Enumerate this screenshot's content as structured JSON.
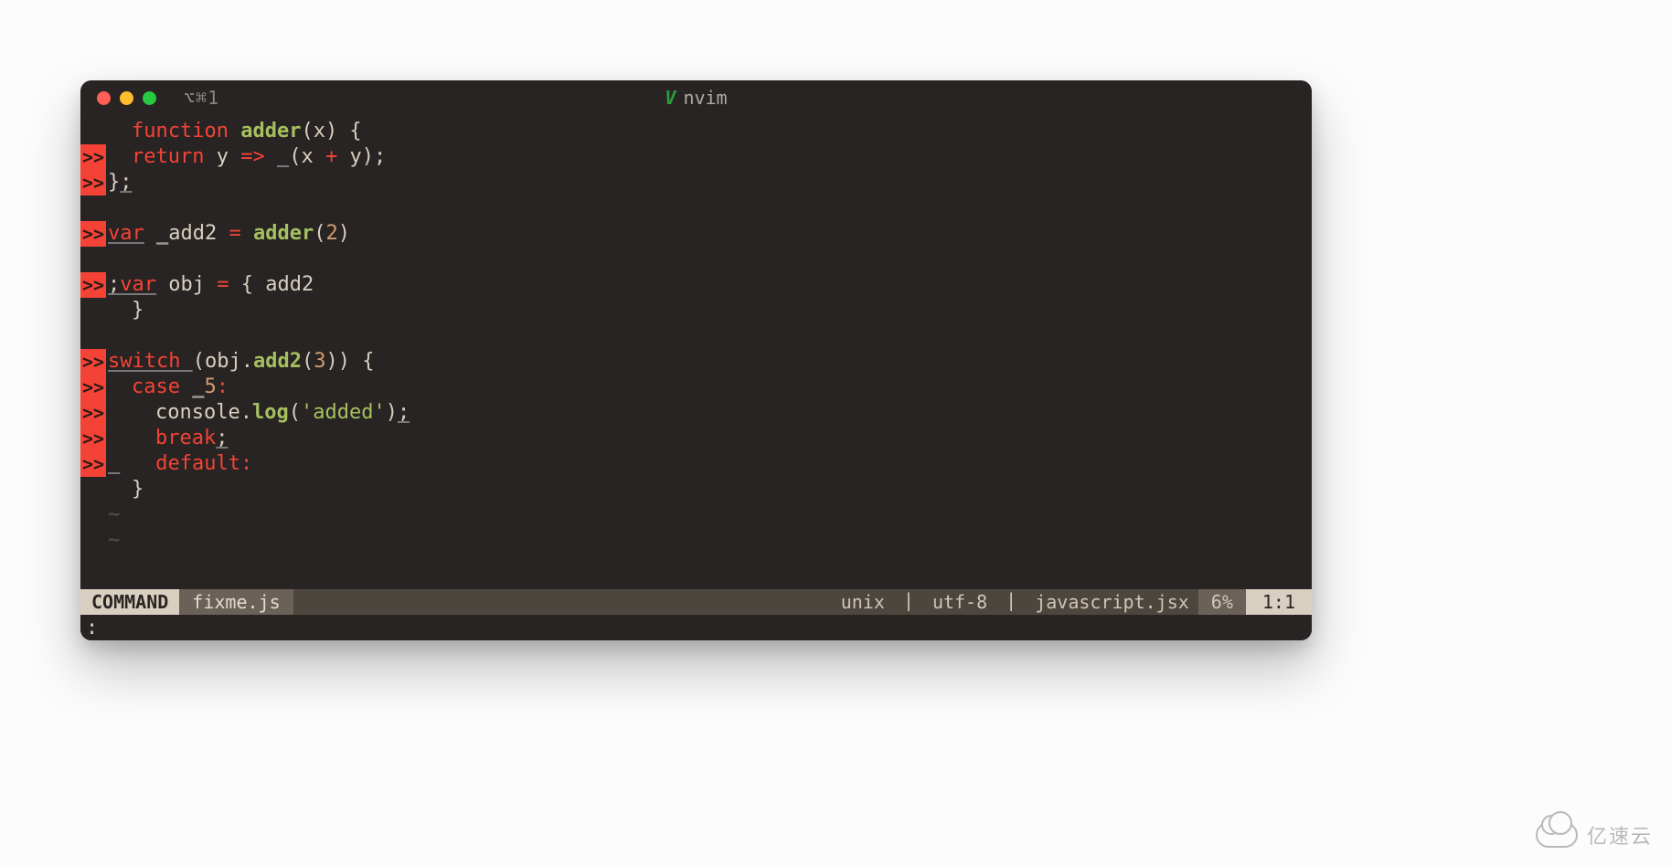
{
  "titlebar": {
    "tab_label": "⌥⌘1",
    "app_icon": "V",
    "app_title": "nvim"
  },
  "gutter_marker": ">>",
  "code": {
    "lines": [
      {
        "err": false,
        "segments": [
          {
            "cls": "indent w2",
            "t": ""
          },
          {
            "cls": "kw",
            "t": "function "
          },
          {
            "cls": "fn",
            "t": "adder"
          },
          {
            "cls": "punct",
            "t": "(x) {"
          }
        ]
      },
      {
        "err": true,
        "segments": [
          {
            "cls": "indent w2",
            "t": ""
          },
          {
            "cls": "kw",
            "t": "return "
          },
          {
            "cls": "ident",
            "t": "y "
          },
          {
            "cls": "kw",
            "t": "=> "
          },
          {
            "cls": "ident ul",
            "t": " "
          },
          {
            "cls": "punct",
            "t": "(x "
          },
          {
            "cls": "kw",
            "t": "+"
          },
          {
            "cls": "punct",
            "t": " y);"
          }
        ]
      },
      {
        "err": true,
        "segments": [
          {
            "cls": "punct",
            "t": "}"
          },
          {
            "cls": "punct ul",
            "t": ";"
          }
        ]
      },
      {
        "err": false,
        "segments": [
          {
            "cls": "",
            "t": ""
          }
        ]
      },
      {
        "err": true,
        "segments": [
          {
            "cls": "kw ul",
            "t": "var"
          },
          {
            "cls": "ident",
            "t": " "
          },
          {
            "cls": "ident ul",
            "t": "_"
          },
          {
            "cls": "ident",
            "t": "add2 "
          },
          {
            "cls": "kw",
            "t": "= "
          },
          {
            "cls": "fn",
            "t": "adder"
          },
          {
            "cls": "punct",
            "t": "("
          },
          {
            "cls": "num",
            "t": "2"
          },
          {
            "cls": "punct",
            "t": ")"
          }
        ]
      },
      {
        "err": false,
        "segments": [
          {
            "cls": "",
            "t": ""
          }
        ]
      },
      {
        "err": true,
        "segments": [
          {
            "cls": "punct ul",
            "t": ";"
          },
          {
            "cls": "kw ul",
            "t": "var"
          },
          {
            "cls": "ident",
            "t": " obj "
          },
          {
            "cls": "kw",
            "t": "= "
          },
          {
            "cls": "punct",
            "t": "{ add2"
          }
        ]
      },
      {
        "err": false,
        "segments": [
          {
            "cls": "indent w2",
            "t": ""
          },
          {
            "cls": "punct",
            "t": "}"
          }
        ]
      },
      {
        "err": false,
        "segments": [
          {
            "cls": "",
            "t": ""
          }
        ]
      },
      {
        "err": true,
        "segments": [
          {
            "cls": "kw ul",
            "t": "switch"
          },
          {
            "cls": "ident ul",
            "t": " "
          },
          {
            "cls": "punct",
            "t": "(obj."
          },
          {
            "cls": "fn",
            "t": "add2"
          },
          {
            "cls": "punct",
            "t": "("
          },
          {
            "cls": "num",
            "t": "3"
          },
          {
            "cls": "punct",
            "t": ")) {"
          }
        ]
      },
      {
        "err": true,
        "segments": [
          {
            "cls": "indent w2",
            "t": ""
          },
          {
            "cls": "kw",
            "t": "case "
          },
          {
            "cls": "ident ul",
            "t": "_"
          },
          {
            "cls": "num",
            "t": "5"
          },
          {
            "cls": "kw",
            "t": ":"
          }
        ]
      },
      {
        "err": true,
        "segments": [
          {
            "cls": "indent w4",
            "t": ""
          },
          {
            "cls": "ident",
            "t": "console."
          },
          {
            "cls": "fn",
            "t": "log"
          },
          {
            "cls": "punct",
            "t": "("
          },
          {
            "cls": "str",
            "t": "'added'"
          },
          {
            "cls": "punct",
            "t": ")"
          },
          {
            "cls": "punct ul",
            "t": ";"
          }
        ]
      },
      {
        "err": true,
        "segments": [
          {
            "cls": "indent w4",
            "t": ""
          },
          {
            "cls": "kw",
            "t": "break"
          },
          {
            "cls": "punct ul",
            "t": ";"
          }
        ]
      },
      {
        "err": true,
        "segments": [
          {
            "cls": "ident ul",
            "t": " "
          },
          {
            "cls": "indent w3",
            "t": ""
          },
          {
            "cls": "kw",
            "t": "default:"
          }
        ]
      },
      {
        "err": false,
        "segments": [
          {
            "cls": "indent w2",
            "t": ""
          },
          {
            "cls": "punct",
            "t": "}"
          }
        ]
      },
      {
        "err": false,
        "segments": [
          {
            "cls": "eob indent w2",
            "t": "~"
          }
        ]
      },
      {
        "err": false,
        "segments": [
          {
            "cls": "eob indent w2",
            "t": "~"
          }
        ]
      }
    ]
  },
  "statusline": {
    "mode": "COMMAND",
    "filename": "fixme.js",
    "fileformat": "unix",
    "encoding": "utf-8",
    "filetype": "javascript.jsx",
    "percent": "6%",
    "position": "1:1",
    "separator": "|"
  },
  "cmdline": {
    "prompt": ":"
  },
  "watermark": {
    "text": "亿速云"
  }
}
